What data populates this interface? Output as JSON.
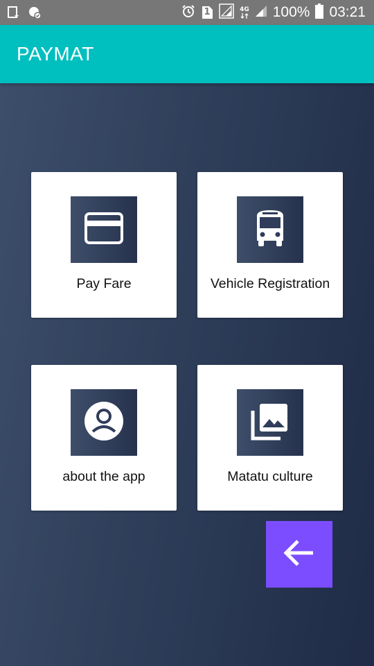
{
  "status_bar": {
    "battery_percent": "100%",
    "time": "03:21",
    "network_type": "4G",
    "sim_slot": "1",
    "icons": [
      "screenshot-icon",
      "shield-icon",
      "alarm-icon",
      "sim-icon",
      "signal-icon",
      "network-4g-icon",
      "signal-icon",
      "battery-icon"
    ]
  },
  "app_bar": {
    "title": "PAYMAT",
    "color": "#00bfbf"
  },
  "menu": {
    "items": [
      {
        "label": "Pay Fare",
        "icon": "credit-card-icon"
      },
      {
        "label": "Vehicle Registration",
        "icon": "bus-icon"
      },
      {
        "label": "about the app",
        "icon": "account-circle-icon"
      },
      {
        "label": "Matatu culture",
        "icon": "photo-library-icon"
      }
    ]
  },
  "fab": {
    "icon": "arrow-back-icon",
    "color": "#7c4dff"
  }
}
